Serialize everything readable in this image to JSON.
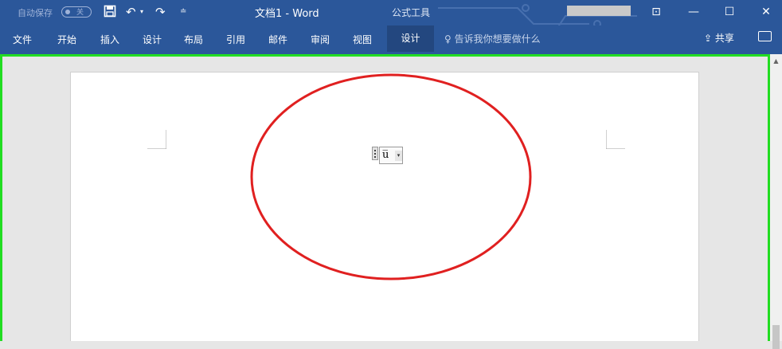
{
  "titlebar": {
    "autosave_label": "自动保存",
    "autosave_state": "关",
    "document_title": "文档1  -  Word",
    "context_tab_group": "公式工具",
    "icons": [
      "save-icon",
      "undo-icon",
      "redo-icon",
      "customize-quick-access-icon"
    ],
    "window_controls": {
      "ribbon_display": "⊡",
      "minimize": "—",
      "maximize": "☐",
      "close": "✕"
    }
  },
  "ribbon": {
    "tabs": [
      "文件",
      "开始",
      "插入",
      "设计",
      "布局",
      "引用",
      "邮件",
      "审阅",
      "视图",
      "设计"
    ],
    "active_context_tab": "设计",
    "tell_me_placeholder": "告诉我你想要做什么",
    "share_label": "共享"
  },
  "document": {
    "equation_text": "u̅",
    "equation_dropdown_glyph": "▾"
  },
  "colors": {
    "ribbon": "#2b579a",
    "page_border_highlight": "#22dd22",
    "annotation_circle": "#e02020"
  }
}
